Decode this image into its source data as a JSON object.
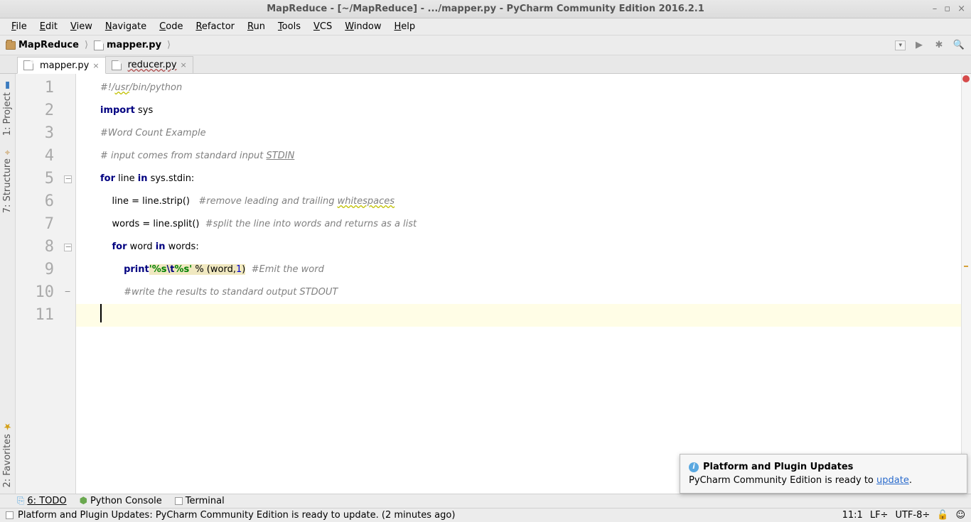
{
  "window": {
    "title": "MapReduce - [~/MapReduce] - .../mapper.py - PyCharm Community Edition 2016.2.1"
  },
  "menu": [
    "File",
    "Edit",
    "View",
    "Navigate",
    "Code",
    "Refactor",
    "Run",
    "Tools",
    "VCS",
    "Window",
    "Help"
  ],
  "breadcrumbs": {
    "project": "MapReduce",
    "file": "mapper.py"
  },
  "tabs": [
    {
      "name": "mapper.py",
      "active": true
    },
    {
      "name": "reducer.py",
      "active": false
    }
  ],
  "left_tools": {
    "project_label": "1: Project",
    "structure_label": "7: Structure",
    "favorites_label": "2: Favorites"
  },
  "code_lines": [
    "#!/usr/bin/python",
    "import sys",
    "#Word Count Example",
    "# input comes from standard input STDIN",
    "for line in sys.stdin:",
    "    line = line.strip()   #remove leading and trailing whitespaces",
    "    words = line.split()  #split the line into words and returns as a list",
    "    for word in words:",
    "        print'%s\\t%s' % (word,1)  #Emit the word",
    "        #write the results to standard output STDOUT",
    ""
  ],
  "bottom_tools": {
    "todo": "6: TODO",
    "pyconsole": "Python Console",
    "terminal": "Terminal"
  },
  "status": {
    "message": "Platform and Plugin Updates: PyCharm Community Edition is ready to update. (2 minutes ago)",
    "pos": "11:1",
    "lineend": "LF÷",
    "enc": "UTF-8÷"
  },
  "notif": {
    "title": "Platform and Plugin Updates",
    "body_prefix": "PyCharm Community Edition is ready to ",
    "link": "update",
    "body_suffix": "."
  }
}
